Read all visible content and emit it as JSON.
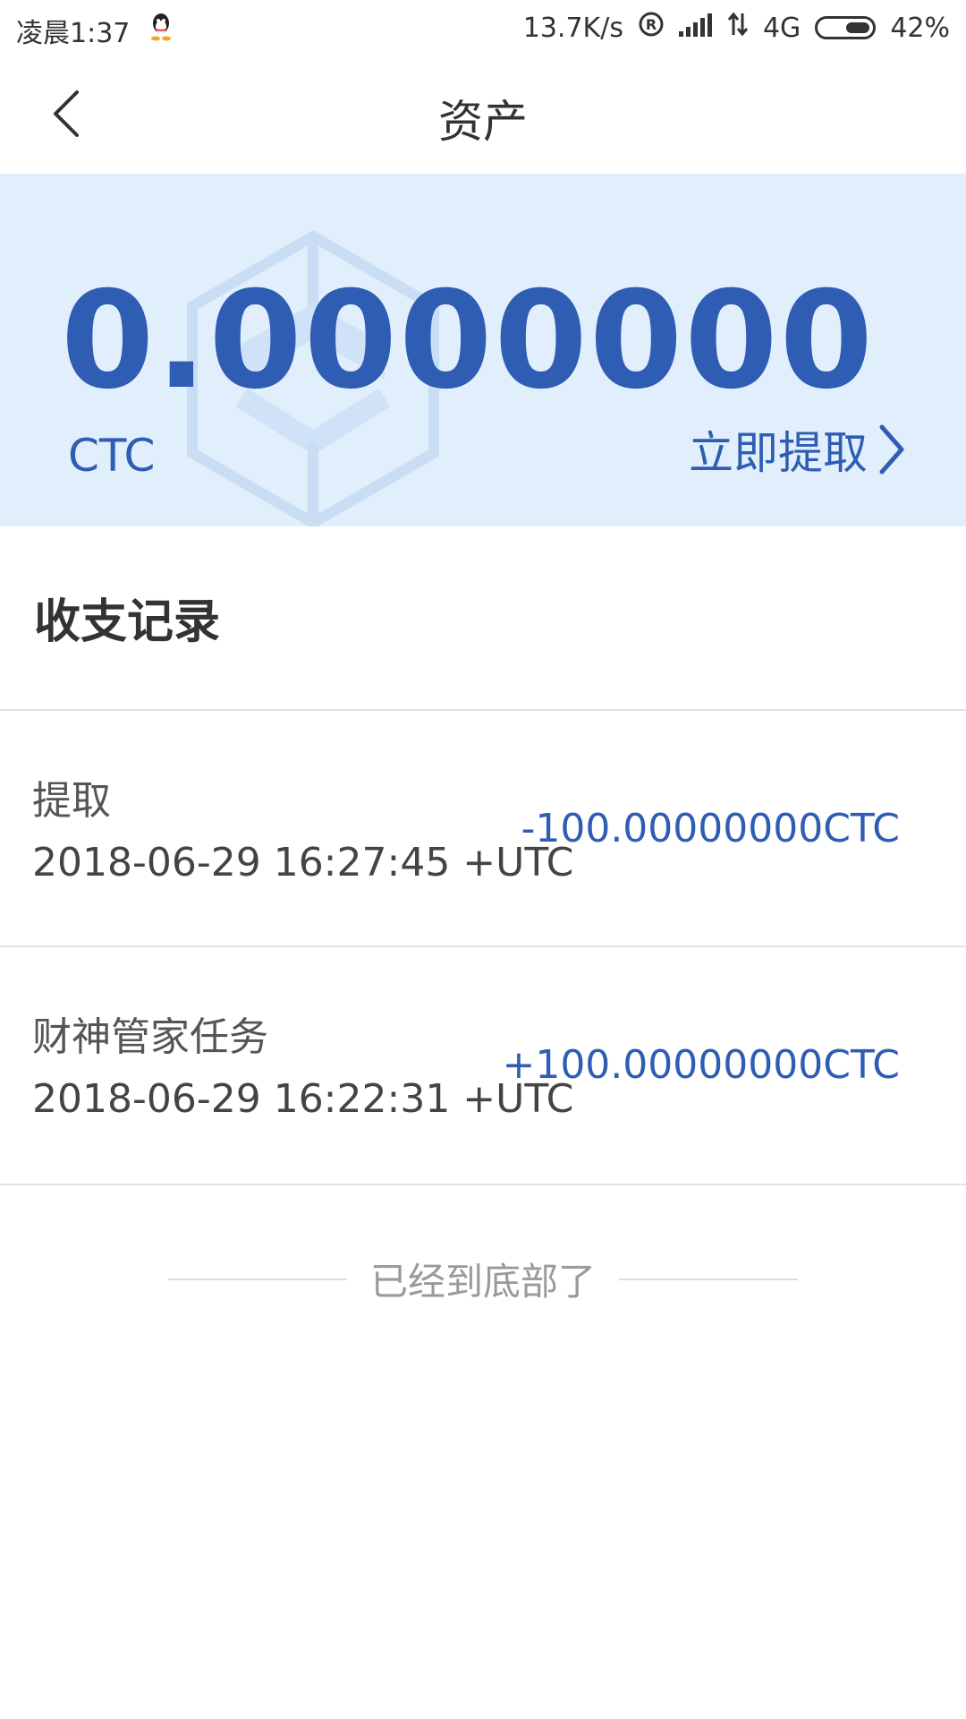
{
  "status_bar": {
    "time": "凌晨1:37",
    "network_speed": "13.7K/s",
    "network_type": "4G",
    "battery": "42%",
    "icons": [
      "qq-icon",
      "registered-icon",
      "signal-icon",
      "data-arrows-icon",
      "battery-icon"
    ]
  },
  "header": {
    "title": "资产",
    "back_icon": "chevron-left-icon"
  },
  "balance": {
    "amount": "0.0000000",
    "unit": "CTC",
    "withdraw_label": "立即提取",
    "withdraw_icon": "chevron-right-icon"
  },
  "records": {
    "title": "收支记录",
    "items": [
      {
        "name": "提取",
        "time": "2018-06-29 16:27:45 +UTC",
        "amount": "-100.00000000CTC"
      },
      {
        "name": "财神管家任务",
        "time": "2018-06-29 16:22:31 +UTC",
        "amount": "+100.00000000CTC"
      }
    ]
  },
  "footer": {
    "end_text": "已经到底部了"
  },
  "colors": {
    "accent": "#2f5db3",
    "card_background": "#e1eefb",
    "divider": "#e3e3e3",
    "text_primary": "#333333",
    "text_muted": "#9a9a9a"
  }
}
